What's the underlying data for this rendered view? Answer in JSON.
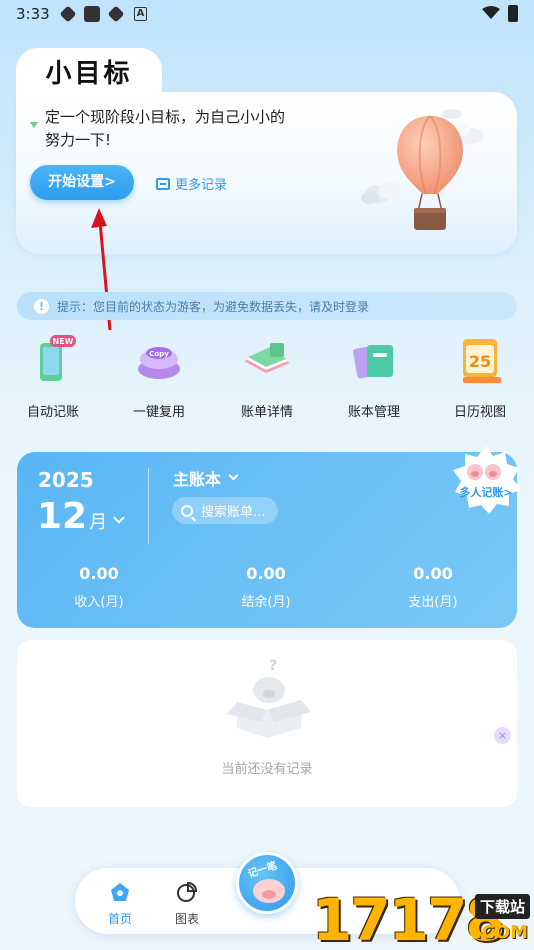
{
  "status_bar": {
    "time": "3:33"
  },
  "goal": {
    "tab_title": "小目标",
    "description": "定一个现阶段小目标，为自己小小的努力一下!",
    "start_button": "开始设置>",
    "more_records": "更多记录"
  },
  "notice": {
    "text": "提示：您目前的状态为游客，为避免数据丢失，请及时登录"
  },
  "quick_actions": [
    {
      "label": "自动记账",
      "icon": "phone-new-icon",
      "badge": "NEW"
    },
    {
      "label": "一键复用",
      "icon": "copy-button-icon",
      "badge": "Copy"
    },
    {
      "label": "账单详情",
      "icon": "open-ledger-icon"
    },
    {
      "label": "账本管理",
      "icon": "notebooks-icon"
    },
    {
      "label": "日历视图",
      "icon": "calendar-icon",
      "badge": "25"
    }
  ],
  "account": {
    "year": "2025",
    "month": "12",
    "month_unit": "月",
    "book_name": "主账本",
    "search_placeholder": "搜索账单...",
    "multi_badge": "多人记账>",
    "stats": [
      {
        "value": "0.00",
        "label": "收入(月)"
      },
      {
        "value": "0.00",
        "label": "结余(月)"
      },
      {
        "value": "0.00",
        "label": "支出(月)"
      }
    ]
  },
  "empty_state": {
    "text": "当前还没有记录",
    "close_mark": "×"
  },
  "bottom_nav": {
    "items": [
      {
        "label": "首页",
        "icon": "home-icon",
        "active": true
      },
      {
        "label": "图表",
        "icon": "pie-chart-icon",
        "active": false
      }
    ],
    "fab_label": "记一笔"
  },
  "watermark": {
    "digits": "17178",
    "cn": "下载站",
    "com": ".COM"
  },
  "colors": {
    "accent": "#2e9bf0",
    "card_blue": "#63bbf5",
    "arrow": "#d6141c"
  }
}
